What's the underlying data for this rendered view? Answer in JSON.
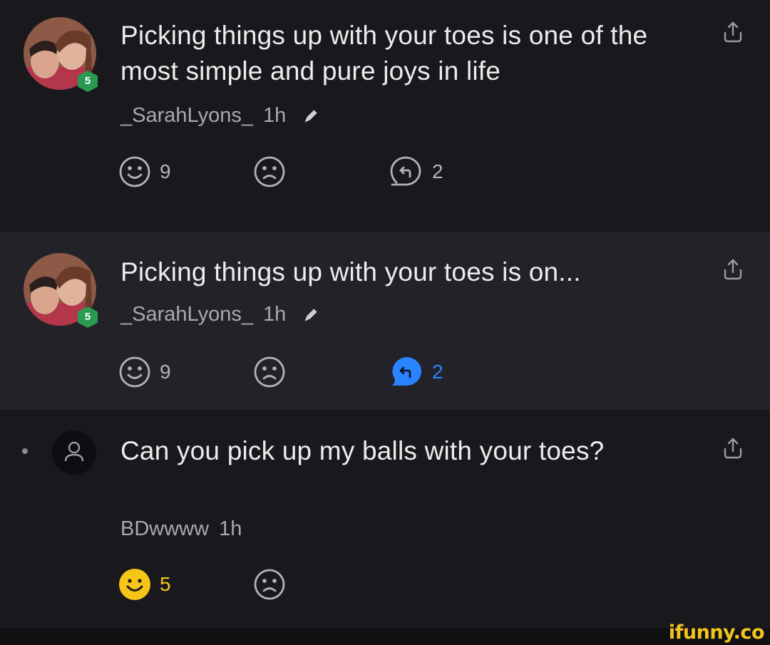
{
  "comments": [
    {
      "text": "Picking things up with your toes is one of the most simple and pure joys in life",
      "author": "_SarahLyons_",
      "time": "1h",
      "level": "5",
      "smile_count": "9",
      "reply_count": "2"
    },
    {
      "text": "Picking things up with your toes is on...",
      "author": "_SarahLyons_",
      "time": "1h",
      "level": "5",
      "smile_count": "9",
      "reply_count": "2"
    },
    {
      "text": "Can you pick up my balls with your toes?",
      "author": "BDwwww",
      "time": "1h",
      "smile_count": "5"
    }
  ],
  "watermark": "ifunny.co",
  "colors": {
    "reply_active": "#2a84ff",
    "smile_active": "#f5c518",
    "level_badge": "#2a9a53"
  }
}
